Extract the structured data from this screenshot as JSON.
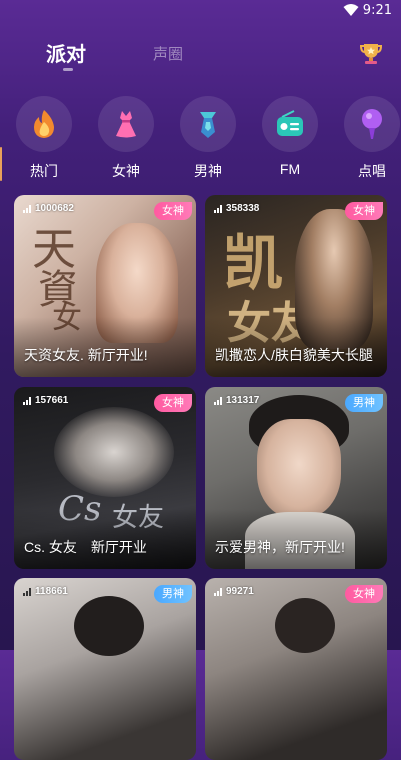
{
  "status_bar": {
    "time": "9:21"
  },
  "top_tabs": {
    "active": "派对",
    "inactive": "声圈"
  },
  "categories": [
    {
      "label": "热门",
      "icon": "flame-icon"
    },
    {
      "label": "女神",
      "icon": "dress-icon"
    },
    {
      "label": "男神",
      "icon": "tie-icon"
    },
    {
      "label": "FM",
      "icon": "radio-icon"
    },
    {
      "label": "点唱",
      "icon": "microphone-icon"
    }
  ],
  "rooms": [
    {
      "count": "1000682",
      "badge": "女神",
      "title": "天资女友. 新厅开业!"
    },
    {
      "count": "358338",
      "badge": "女神",
      "title": "凯撒恋人/肤白貌美大长腿"
    },
    {
      "count": "157661",
      "badge": "女神",
      "title": "Cs. 女友　新厅开业"
    },
    {
      "count": "131317",
      "badge": "男神",
      "title": "示爱男神，新厅开业!"
    },
    {
      "count": "118661",
      "badge": "男神",
      "title": ""
    },
    {
      "count": "99271",
      "badge": "女神",
      "title": ""
    }
  ],
  "colors": {
    "goddess_badge": "#ff5aa0",
    "god_badge": "#4aa8ff",
    "background_top": "#5a2b95",
    "background_bottom": "#281650"
  }
}
